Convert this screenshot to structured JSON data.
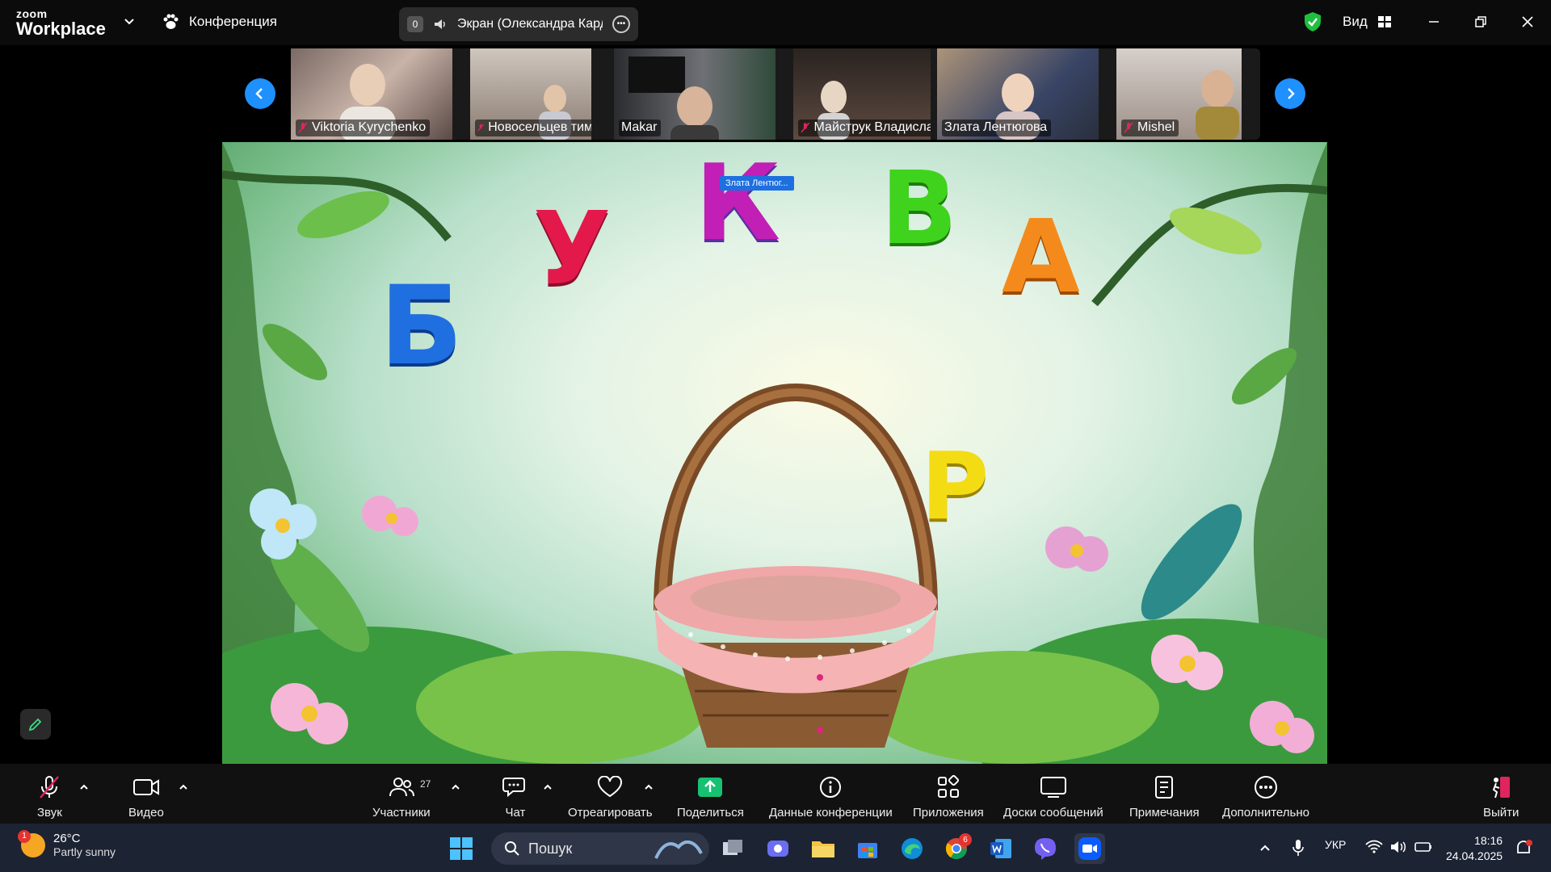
{
  "topbar": {
    "logo_small": "zoom",
    "logo_big": "Workplace",
    "conference_label": "Конференция",
    "share_badge": "0",
    "share_text": "Экран (Олександра Кардаш)",
    "view_label": "Вид"
  },
  "participants": [
    {
      "name": "Viktoria  Kyrychenko",
      "muted": true
    },
    {
      "name": "Новосельцев тимофі...",
      "muted": true
    },
    {
      "name": "Makar",
      "muted": false
    },
    {
      "name": "Майструк Владислава",
      "muted": true
    },
    {
      "name": "Злата Лентюгова",
      "muted": false
    },
    {
      "name": "Mishel",
      "muted": true
    }
  ],
  "stage": {
    "cursor_label": "Злата Лентюг...",
    "letters": [
      "У",
      "К",
      "В",
      "А",
      "Б",
      "Р"
    ]
  },
  "toolbar": {
    "audio": "Звук",
    "video": "Видео",
    "participants": "Участники",
    "participants_count": "27",
    "chat": "Чат",
    "react": "Отреагировать",
    "share": "Поделиться",
    "info": "Данные конференции",
    "apps": "Приложения",
    "whiteboards": "Доски сообщений",
    "notes": "Примечания",
    "more": "Дополнительно",
    "leave": "Выйти"
  },
  "taskbar": {
    "weather_temp": "26°C",
    "weather_desc": "Partly sunny",
    "weather_badge": "1",
    "search": "Пошук",
    "chrome_badge": "6",
    "lang": "УКР",
    "time": "18:16",
    "date": "24.04.2025"
  },
  "colors": {
    "accent_blue": "#1e90ff",
    "share_green": "#16c172",
    "shield_green": "#1fbf3f",
    "muted_red": "#e0245e"
  }
}
